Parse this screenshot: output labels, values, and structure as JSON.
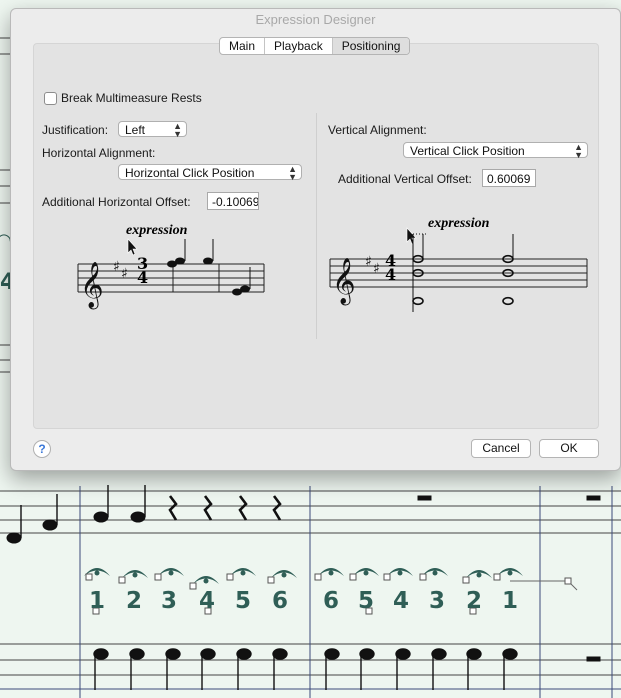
{
  "dialog": {
    "title": "Expression Designer",
    "tabs": [
      {
        "label": "Main"
      },
      {
        "label": "Playback"
      },
      {
        "label": "Positioning"
      }
    ],
    "break_multimeasure_rests": {
      "label": "Break Multimeasure Rests",
      "checked": false
    },
    "justification": {
      "label": "Justification:",
      "value": "Left"
    },
    "horizontal_alignment": {
      "label": "Horizontal Alignment:",
      "value": "Horizontal Click Position"
    },
    "additional_horizontal_offset": {
      "label": "Additional Horizontal Offset:",
      "value": "-0.10069"
    },
    "vertical_alignment": {
      "label": "Vertical Alignment:",
      "value": "Vertical Click Position"
    },
    "additional_vertical_offset": {
      "label": "Additional Vertical Offset:",
      "value": "0.60069"
    },
    "preview_left": {
      "expression": "expression",
      "time_sig_top": "3",
      "time_sig_bottom": "4"
    },
    "preview_right": {
      "expression": "expression",
      "time_sig_top": "4",
      "time_sig_bottom": "4"
    },
    "help_label": "?",
    "cancel_label": "Cancel",
    "ok_label": "OK"
  },
  "score": {
    "fingering_left": [
      "1",
      "2",
      "3",
      "4",
      "5",
      "6"
    ],
    "fingering_right": [
      "6",
      "5",
      "4",
      "3",
      "2",
      "1"
    ],
    "edge_digit": "4"
  }
}
